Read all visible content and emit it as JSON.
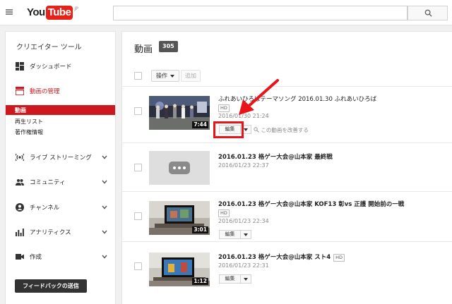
{
  "header": {
    "logo_you": "You",
    "logo_tube": "Tube",
    "logo_region": "JP",
    "search_value": ""
  },
  "sidebar": {
    "title": "クリエイター ツール",
    "dashboard": "ダッシュボード",
    "video_manager": "動画の管理",
    "sub_items": [
      "動画",
      "再生リスト",
      "著作権情報"
    ],
    "live_streaming": "ライブ ストリーミング",
    "community": "コミュニティ",
    "channel": "チャンネル",
    "analytics": "アナリティクス",
    "create": "作成",
    "feedback": "フィードバックの送信"
  },
  "main": {
    "title": "動画",
    "count": "305",
    "actions_label": "操作",
    "add_label": "追加",
    "edit_label": "編集",
    "improve_label": "この動画を改善する",
    "hd_label": "HD",
    "videos": [
      {
        "title": "ふれあいひろばテーマソング 2016.01.30 ふれあいひろば",
        "date": "2016/01/30 21:24",
        "duration": "7:44",
        "hd": true
      },
      {
        "title": "2016.01.23 格ゲー大会@山本家 最終戦",
        "date": "2016/01/23 22:37",
        "duration": "",
        "hd": false
      },
      {
        "title": "2016.01.23 格ゲー大会@山本家 KOF13 彰vs 正護 開始前の一戦",
        "date": "2016/01/23 22:34",
        "duration": "3:01",
        "hd": true
      },
      {
        "title": "2016.01.23 格ゲー大会@山本家 スト4",
        "date": "2016/01/23 22:31",
        "duration": "1:12",
        "hd": true
      }
    ]
  },
  "colors": {
    "brand_red": "#cc181e",
    "annotation_red": "#e8141a"
  }
}
